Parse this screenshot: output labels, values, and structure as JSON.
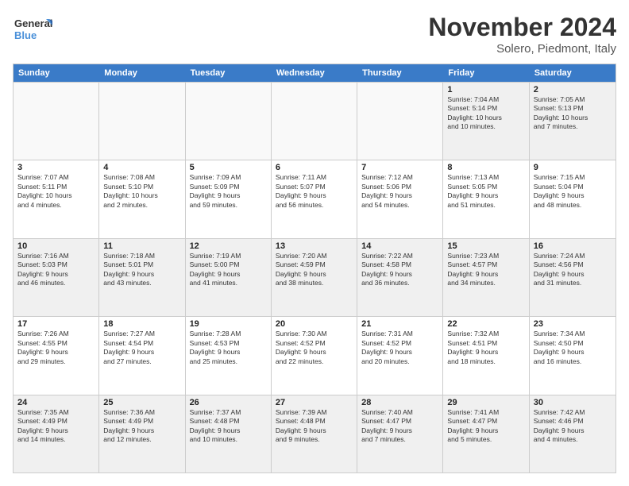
{
  "logo": {
    "line1": "General",
    "line2": "Blue"
  },
  "title": "November 2024",
  "location": "Solero, Piedmont, Italy",
  "header_days": [
    "Sunday",
    "Monday",
    "Tuesday",
    "Wednesday",
    "Thursday",
    "Friday",
    "Saturday"
  ],
  "rows": [
    [
      {
        "day": "",
        "text": ""
      },
      {
        "day": "",
        "text": ""
      },
      {
        "day": "",
        "text": ""
      },
      {
        "day": "",
        "text": ""
      },
      {
        "day": "",
        "text": ""
      },
      {
        "day": "1",
        "text": "Sunrise: 7:04 AM\nSunset: 5:14 PM\nDaylight: 10 hours\nand 10 minutes."
      },
      {
        "day": "2",
        "text": "Sunrise: 7:05 AM\nSunset: 5:13 PM\nDaylight: 10 hours\nand 7 minutes."
      }
    ],
    [
      {
        "day": "3",
        "text": "Sunrise: 7:07 AM\nSunset: 5:11 PM\nDaylight: 10 hours\nand 4 minutes."
      },
      {
        "day": "4",
        "text": "Sunrise: 7:08 AM\nSunset: 5:10 PM\nDaylight: 10 hours\nand 2 minutes."
      },
      {
        "day": "5",
        "text": "Sunrise: 7:09 AM\nSunset: 5:09 PM\nDaylight: 9 hours\nand 59 minutes."
      },
      {
        "day": "6",
        "text": "Sunrise: 7:11 AM\nSunset: 5:07 PM\nDaylight: 9 hours\nand 56 minutes."
      },
      {
        "day": "7",
        "text": "Sunrise: 7:12 AM\nSunset: 5:06 PM\nDaylight: 9 hours\nand 54 minutes."
      },
      {
        "day": "8",
        "text": "Sunrise: 7:13 AM\nSunset: 5:05 PM\nDaylight: 9 hours\nand 51 minutes."
      },
      {
        "day": "9",
        "text": "Sunrise: 7:15 AM\nSunset: 5:04 PM\nDaylight: 9 hours\nand 48 minutes."
      }
    ],
    [
      {
        "day": "10",
        "text": "Sunrise: 7:16 AM\nSunset: 5:03 PM\nDaylight: 9 hours\nand 46 minutes."
      },
      {
        "day": "11",
        "text": "Sunrise: 7:18 AM\nSunset: 5:01 PM\nDaylight: 9 hours\nand 43 minutes."
      },
      {
        "day": "12",
        "text": "Sunrise: 7:19 AM\nSunset: 5:00 PM\nDaylight: 9 hours\nand 41 minutes."
      },
      {
        "day": "13",
        "text": "Sunrise: 7:20 AM\nSunset: 4:59 PM\nDaylight: 9 hours\nand 38 minutes."
      },
      {
        "day": "14",
        "text": "Sunrise: 7:22 AM\nSunset: 4:58 PM\nDaylight: 9 hours\nand 36 minutes."
      },
      {
        "day": "15",
        "text": "Sunrise: 7:23 AM\nSunset: 4:57 PM\nDaylight: 9 hours\nand 34 minutes."
      },
      {
        "day": "16",
        "text": "Sunrise: 7:24 AM\nSunset: 4:56 PM\nDaylight: 9 hours\nand 31 minutes."
      }
    ],
    [
      {
        "day": "17",
        "text": "Sunrise: 7:26 AM\nSunset: 4:55 PM\nDaylight: 9 hours\nand 29 minutes."
      },
      {
        "day": "18",
        "text": "Sunrise: 7:27 AM\nSunset: 4:54 PM\nDaylight: 9 hours\nand 27 minutes."
      },
      {
        "day": "19",
        "text": "Sunrise: 7:28 AM\nSunset: 4:53 PM\nDaylight: 9 hours\nand 25 minutes."
      },
      {
        "day": "20",
        "text": "Sunrise: 7:30 AM\nSunset: 4:52 PM\nDaylight: 9 hours\nand 22 minutes."
      },
      {
        "day": "21",
        "text": "Sunrise: 7:31 AM\nSunset: 4:52 PM\nDaylight: 9 hours\nand 20 minutes."
      },
      {
        "day": "22",
        "text": "Sunrise: 7:32 AM\nSunset: 4:51 PM\nDaylight: 9 hours\nand 18 minutes."
      },
      {
        "day": "23",
        "text": "Sunrise: 7:34 AM\nSunset: 4:50 PM\nDaylight: 9 hours\nand 16 minutes."
      }
    ],
    [
      {
        "day": "24",
        "text": "Sunrise: 7:35 AM\nSunset: 4:49 PM\nDaylight: 9 hours\nand 14 minutes."
      },
      {
        "day": "25",
        "text": "Sunrise: 7:36 AM\nSunset: 4:49 PM\nDaylight: 9 hours\nand 12 minutes."
      },
      {
        "day": "26",
        "text": "Sunrise: 7:37 AM\nSunset: 4:48 PM\nDaylight: 9 hours\nand 10 minutes."
      },
      {
        "day": "27",
        "text": "Sunrise: 7:39 AM\nSunset: 4:48 PM\nDaylight: 9 hours\nand 9 minutes."
      },
      {
        "day": "28",
        "text": "Sunrise: 7:40 AM\nSunset: 4:47 PM\nDaylight: 9 hours\nand 7 minutes."
      },
      {
        "day": "29",
        "text": "Sunrise: 7:41 AM\nSunset: 4:47 PM\nDaylight: 9 hours\nand 5 minutes."
      },
      {
        "day": "30",
        "text": "Sunrise: 7:42 AM\nSunset: 4:46 PM\nDaylight: 9 hours\nand 4 minutes."
      }
    ]
  ]
}
